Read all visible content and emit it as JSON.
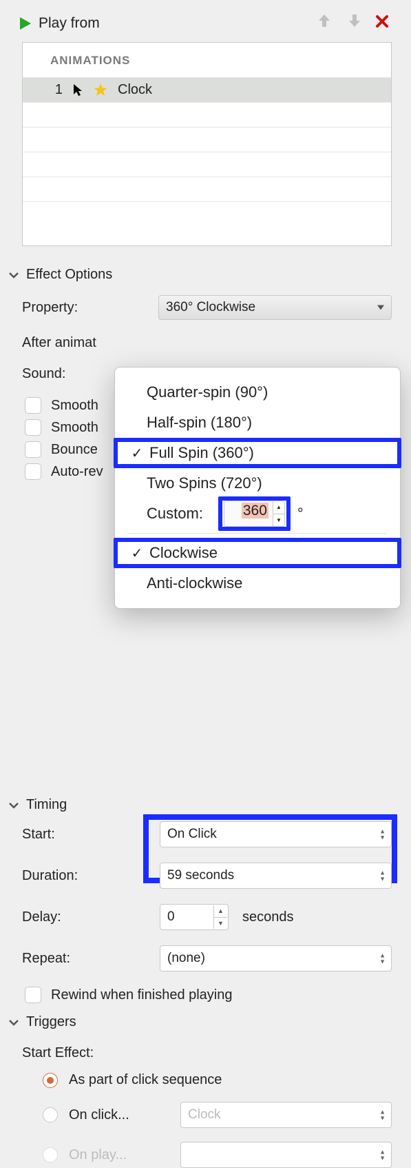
{
  "topbar": {
    "play_label": "Play from"
  },
  "animations": {
    "header": "ANIMATIONS",
    "rows": [
      {
        "index": "1",
        "name": "Clock"
      }
    ]
  },
  "effect": {
    "section_title": "Effect Options",
    "property_label": "Property:",
    "property_value": "360° Clockwise",
    "after_anim_label": "After animat",
    "sound_label": "Sound:",
    "checks": {
      "smooth1": "Smooth",
      "smooth2": "Smooth",
      "bounce": "Bounce",
      "autorev": "Auto-rev"
    },
    "dropdown": {
      "items": [
        {
          "label": "Quarter-spin (90°)",
          "checked": false
        },
        {
          "label": "Half-spin (180°)",
          "checked": false
        },
        {
          "label": "Full Spin (360°)",
          "checked": true
        },
        {
          "label": "Two Spins (720°)",
          "checked": false
        }
      ],
      "custom_label": "Custom:",
      "custom_value": "360",
      "degree": "°",
      "direction": [
        {
          "label": "Clockwise",
          "checked": true
        },
        {
          "label": "Anti-clockwise",
          "checked": false
        }
      ]
    }
  },
  "timing": {
    "section_title": "Timing",
    "start_label": "Start:",
    "start_value": "On Click",
    "duration_label": "Duration:",
    "duration_value": "59 seconds",
    "delay_label": "Delay:",
    "delay_value": "0",
    "delay_unit": "seconds",
    "repeat_label": "Repeat:",
    "repeat_value": "(none)",
    "rewind_label": "Rewind when finished playing"
  },
  "triggers": {
    "section_title": "Triggers",
    "start_effect_label": "Start Effect:",
    "radios": {
      "seq": "As part of click sequence",
      "onclick": "On click...",
      "onclick_target": "Clock",
      "onplay": "On play..."
    }
  }
}
